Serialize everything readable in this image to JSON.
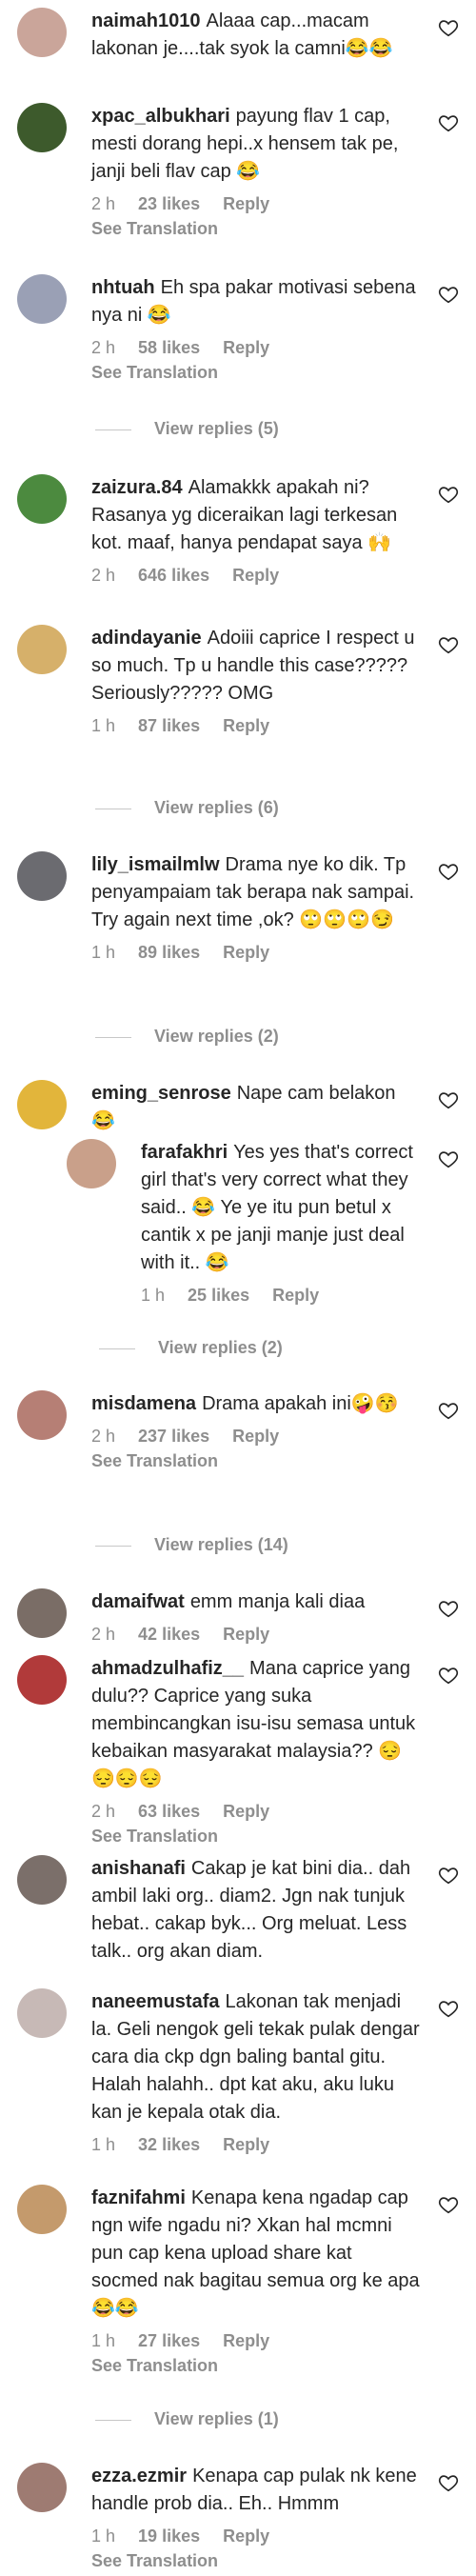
{
  "actions": {
    "likes_suffix": "likes",
    "reply_label": "Reply",
    "see_translation": "See Translation"
  },
  "comments": [
    {
      "user": "naimah1010",
      "text": "Alaaa cap...macam lakonan je....tak syok la camni😂😂",
      "time": "",
      "likes": "",
      "avatar": "#caa59a",
      "see_translation": false
    },
    {
      "user": "xpac_albukhari",
      "text": "payung flav 1 cap, mesti dorang hepi..x hensem tak pe, janji beli flav cap 😂",
      "time": "2 h",
      "likes": "23",
      "avatar": "#3d5a2c",
      "see_translation": true
    },
    {
      "user": "nhtuah",
      "text": "Eh spa pakar motivasi sebena nya ni 😂",
      "time": "2 h",
      "likes": "58",
      "avatar": "#9aa0b5",
      "see_translation": true,
      "view_replies": "View replies (5)"
    },
    {
      "user": "zaizura.84",
      "text": "Alamakkk apakah ni? Rasanya yg diceraikan lagi terkesan kot. maaf, hanya pendapat saya 🙌",
      "time": "2 h",
      "likes": "646",
      "avatar": "#4c8a3f",
      "see_translation": false
    },
    {
      "user": "adindayanie",
      "text": "Adoiii caprice I respect u so much. Tp u handle this case????? Seriously????? OMG",
      "time": "1 h",
      "likes": "87",
      "avatar": "#d6b06a",
      "see_translation": false,
      "view_replies": "View replies (6)"
    },
    {
      "user": "lily_ismailmlw",
      "text": "Drama nye ko dik. Tp penyampaiam tak berapa nak sampai. Try again next time ,ok? 🙄🙄🙄😏",
      "time": "1 h",
      "likes": "89",
      "avatar": "#6b6b70",
      "see_translation": false,
      "view_replies": "View replies (2)"
    },
    {
      "user": "eming_senrose",
      "text": "Nape cam belakon 😂",
      "time": "",
      "likes": "",
      "avatar": "#e2b53b",
      "see_translation": false
    },
    {
      "user": "farafakhri",
      "text": "Yes yes that's correct girl that's very correct what they said.. 😂 Ye ye itu pun betul x cantik x pe janji manje just deal with it.. 😂",
      "time": "1 h",
      "likes": "25",
      "avatar": "#c9a08a",
      "see_translation": false,
      "reply": true,
      "view_replies": "View replies (2)"
    },
    {
      "user": "misdamena",
      "text": "Drama apakah ini🤪😚",
      "time": "2 h",
      "likes": "237",
      "avatar": "#b67f75",
      "see_translation": true,
      "view_replies": "View replies (14)"
    },
    {
      "user": "damaifwat",
      "text": "emm manja kali diaa",
      "time": "2 h",
      "likes": "42",
      "avatar": "#7a6d66",
      "see_translation": false
    },
    {
      "user": "ahmadzulhafiz__",
      "text": "Mana caprice yang dulu?? Caprice yang suka membincangkan isu-isu semasa untuk kebaikan masyarakat malaysia?? 😔😔😔😔",
      "time": "2 h",
      "likes": "63",
      "avatar": "#b13a3a",
      "see_translation": true
    },
    {
      "user": "anishanafi",
      "text": "Cakap je kat bini dia.. dah ambil laki org.. diam2. Jgn nak tunjuk hebat.. cakap byk... Org meluat. Less talk.. org akan diam.",
      "time": "",
      "likes": "",
      "avatar": "#7b6f6a",
      "see_translation": false
    },
    {
      "user": "naneemustafa",
      "text": "Lakonan tak menjadi la. Geli nengok geli tekak pulak dengar cara dia ckp dgn baling bantal gitu. Halah halahh.. dpt kat aku, aku luku kan je kepala otak dia.",
      "time": "1 h",
      "likes": "32",
      "avatar": "#c7b9b6",
      "see_translation": false
    },
    {
      "user": "faznifahmi",
      "text": "Kenapa kena ngadap cap ngn wife ngadu ni? Xkan hal mcmni pun cap kena upload share kat socmed nak bagitau semua org ke apa😂😂",
      "time": "1 h",
      "likes": "27",
      "avatar": "#c49a6c",
      "see_translation": true,
      "view_replies": "View replies (1)"
    },
    {
      "user": "ezza.ezmir",
      "text": "Kenapa cap pulak nk kene handle prob dia.. Eh.. Hmmm",
      "time": "1 h",
      "likes": "19",
      "avatar": "#9e7b72",
      "see_translation": true
    }
  ]
}
